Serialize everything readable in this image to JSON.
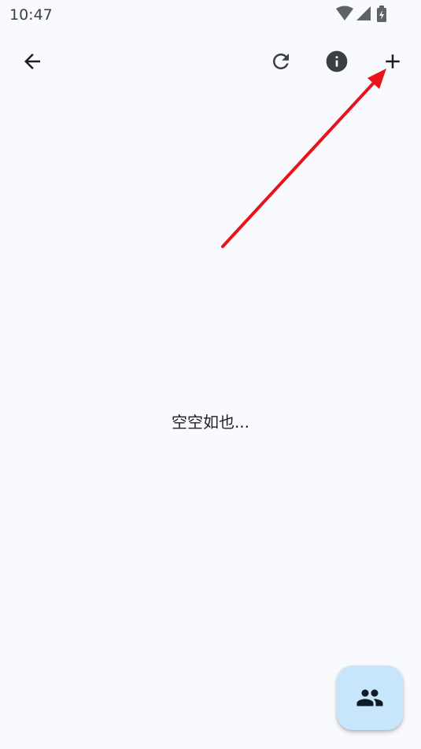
{
  "status_bar": {
    "time": "10:47",
    "icons": [
      "wifi-icon",
      "signal-icon",
      "battery-charging-icon"
    ]
  },
  "toolbar": {
    "back_icon": "arrow-back-icon",
    "refresh_icon": "refresh-icon",
    "info_icon": "info-icon",
    "add_icon": "plus-icon"
  },
  "main": {
    "empty_message": "空空如也..."
  },
  "fab": {
    "icon": "people-icon"
  },
  "colors": {
    "background": "#f9fafe",
    "icon": "#3c3f44",
    "fab_background": "#c8e6fb",
    "fab_icon": "#0f1c28",
    "annotation_arrow": "#e8141b"
  }
}
